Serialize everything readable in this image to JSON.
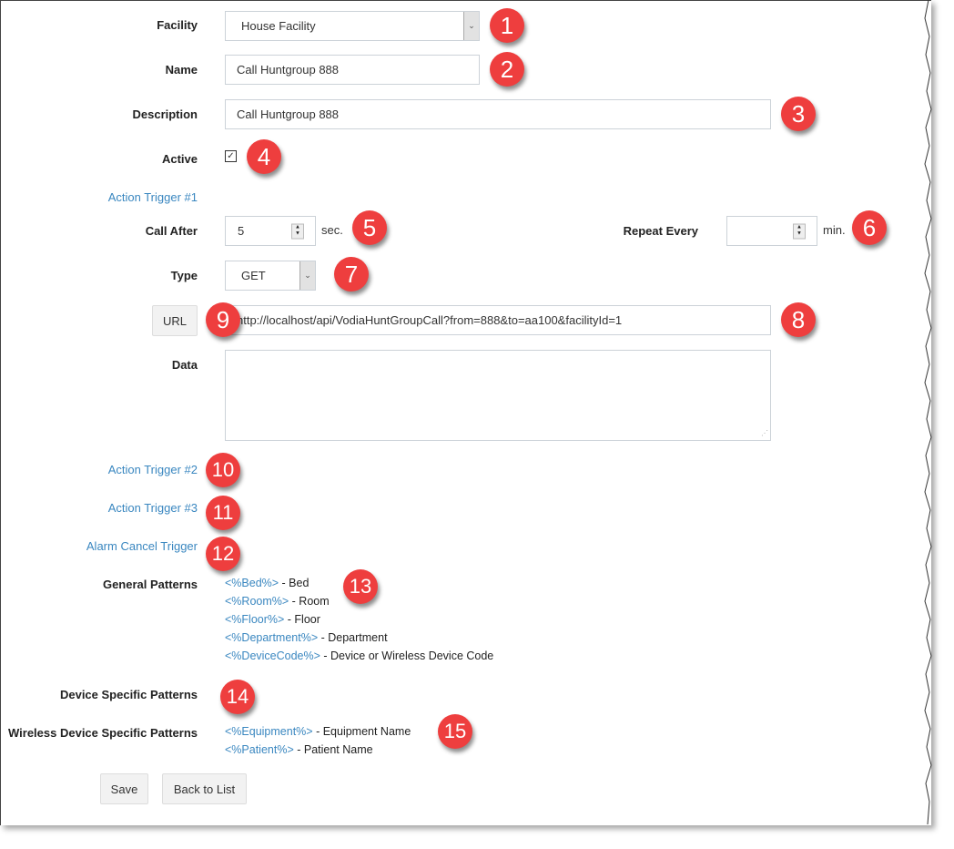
{
  "form": {
    "facility": {
      "label": "Facility",
      "value": "House Facility"
    },
    "name": {
      "label": "Name",
      "value": "Call Huntgroup 888"
    },
    "description": {
      "label": "Description",
      "value": "Call Huntgroup 888"
    },
    "active": {
      "label": "Active",
      "checked": true,
      "check_glyph": "✓"
    },
    "action_trigger_1": {
      "link": "Action Trigger #1",
      "call_after": {
        "label": "Call After",
        "value": "5",
        "unit": "sec."
      },
      "repeat_every": {
        "label": "Repeat Every",
        "value": "",
        "unit": "min."
      },
      "type": {
        "label": "Type",
        "value": "GET"
      },
      "url": {
        "button": "URL",
        "value": "http://localhost/api/VodiaHuntGroupCall?from=888&to=aa100&facilityId=1"
      },
      "data": {
        "label": "Data",
        "value": ""
      }
    },
    "action_trigger_2": {
      "link": "Action Trigger #2"
    },
    "action_trigger_3": {
      "link": "Action Trigger #3"
    },
    "alarm_cancel_trigger": {
      "link": "Alarm Cancel Trigger"
    },
    "general_patterns": {
      "label": "General Patterns",
      "items": [
        {
          "token": "<%Bed%>",
          "desc": " - Bed"
        },
        {
          "token": "<%Room%>",
          "desc": " - Room"
        },
        {
          "token": "<%Floor%>",
          "desc": " - Floor"
        },
        {
          "token": "<%Department%>",
          "desc": " - Department"
        },
        {
          "token": "<%DeviceCode%>",
          "desc": " - Device or Wireless Device Code"
        }
      ]
    },
    "device_specific_patterns": {
      "label": "Device Specific Patterns"
    },
    "wireless_device_specific_patterns": {
      "label": "Wireless Device Specific Patterns",
      "items": [
        {
          "token": "<%Equipment%>",
          "desc": " - Equipment Name"
        },
        {
          "token": "<%Patient%>",
          "desc": " - Patient Name"
        }
      ]
    },
    "buttons": {
      "save": "Save",
      "back": "Back to List"
    }
  },
  "callouts": [
    "1",
    "2",
    "3",
    "4",
    "5",
    "6",
    "7",
    "8",
    "9",
    "10",
    "11",
    "12",
    "13",
    "14",
    "15"
  ],
  "icons": {
    "select_arrow": "⌄",
    "spin_up": "▲",
    "spin_down": "▼",
    "resize": "⋰"
  },
  "colors": {
    "link": "#3a87c0",
    "callout": "#ee3e3e"
  }
}
